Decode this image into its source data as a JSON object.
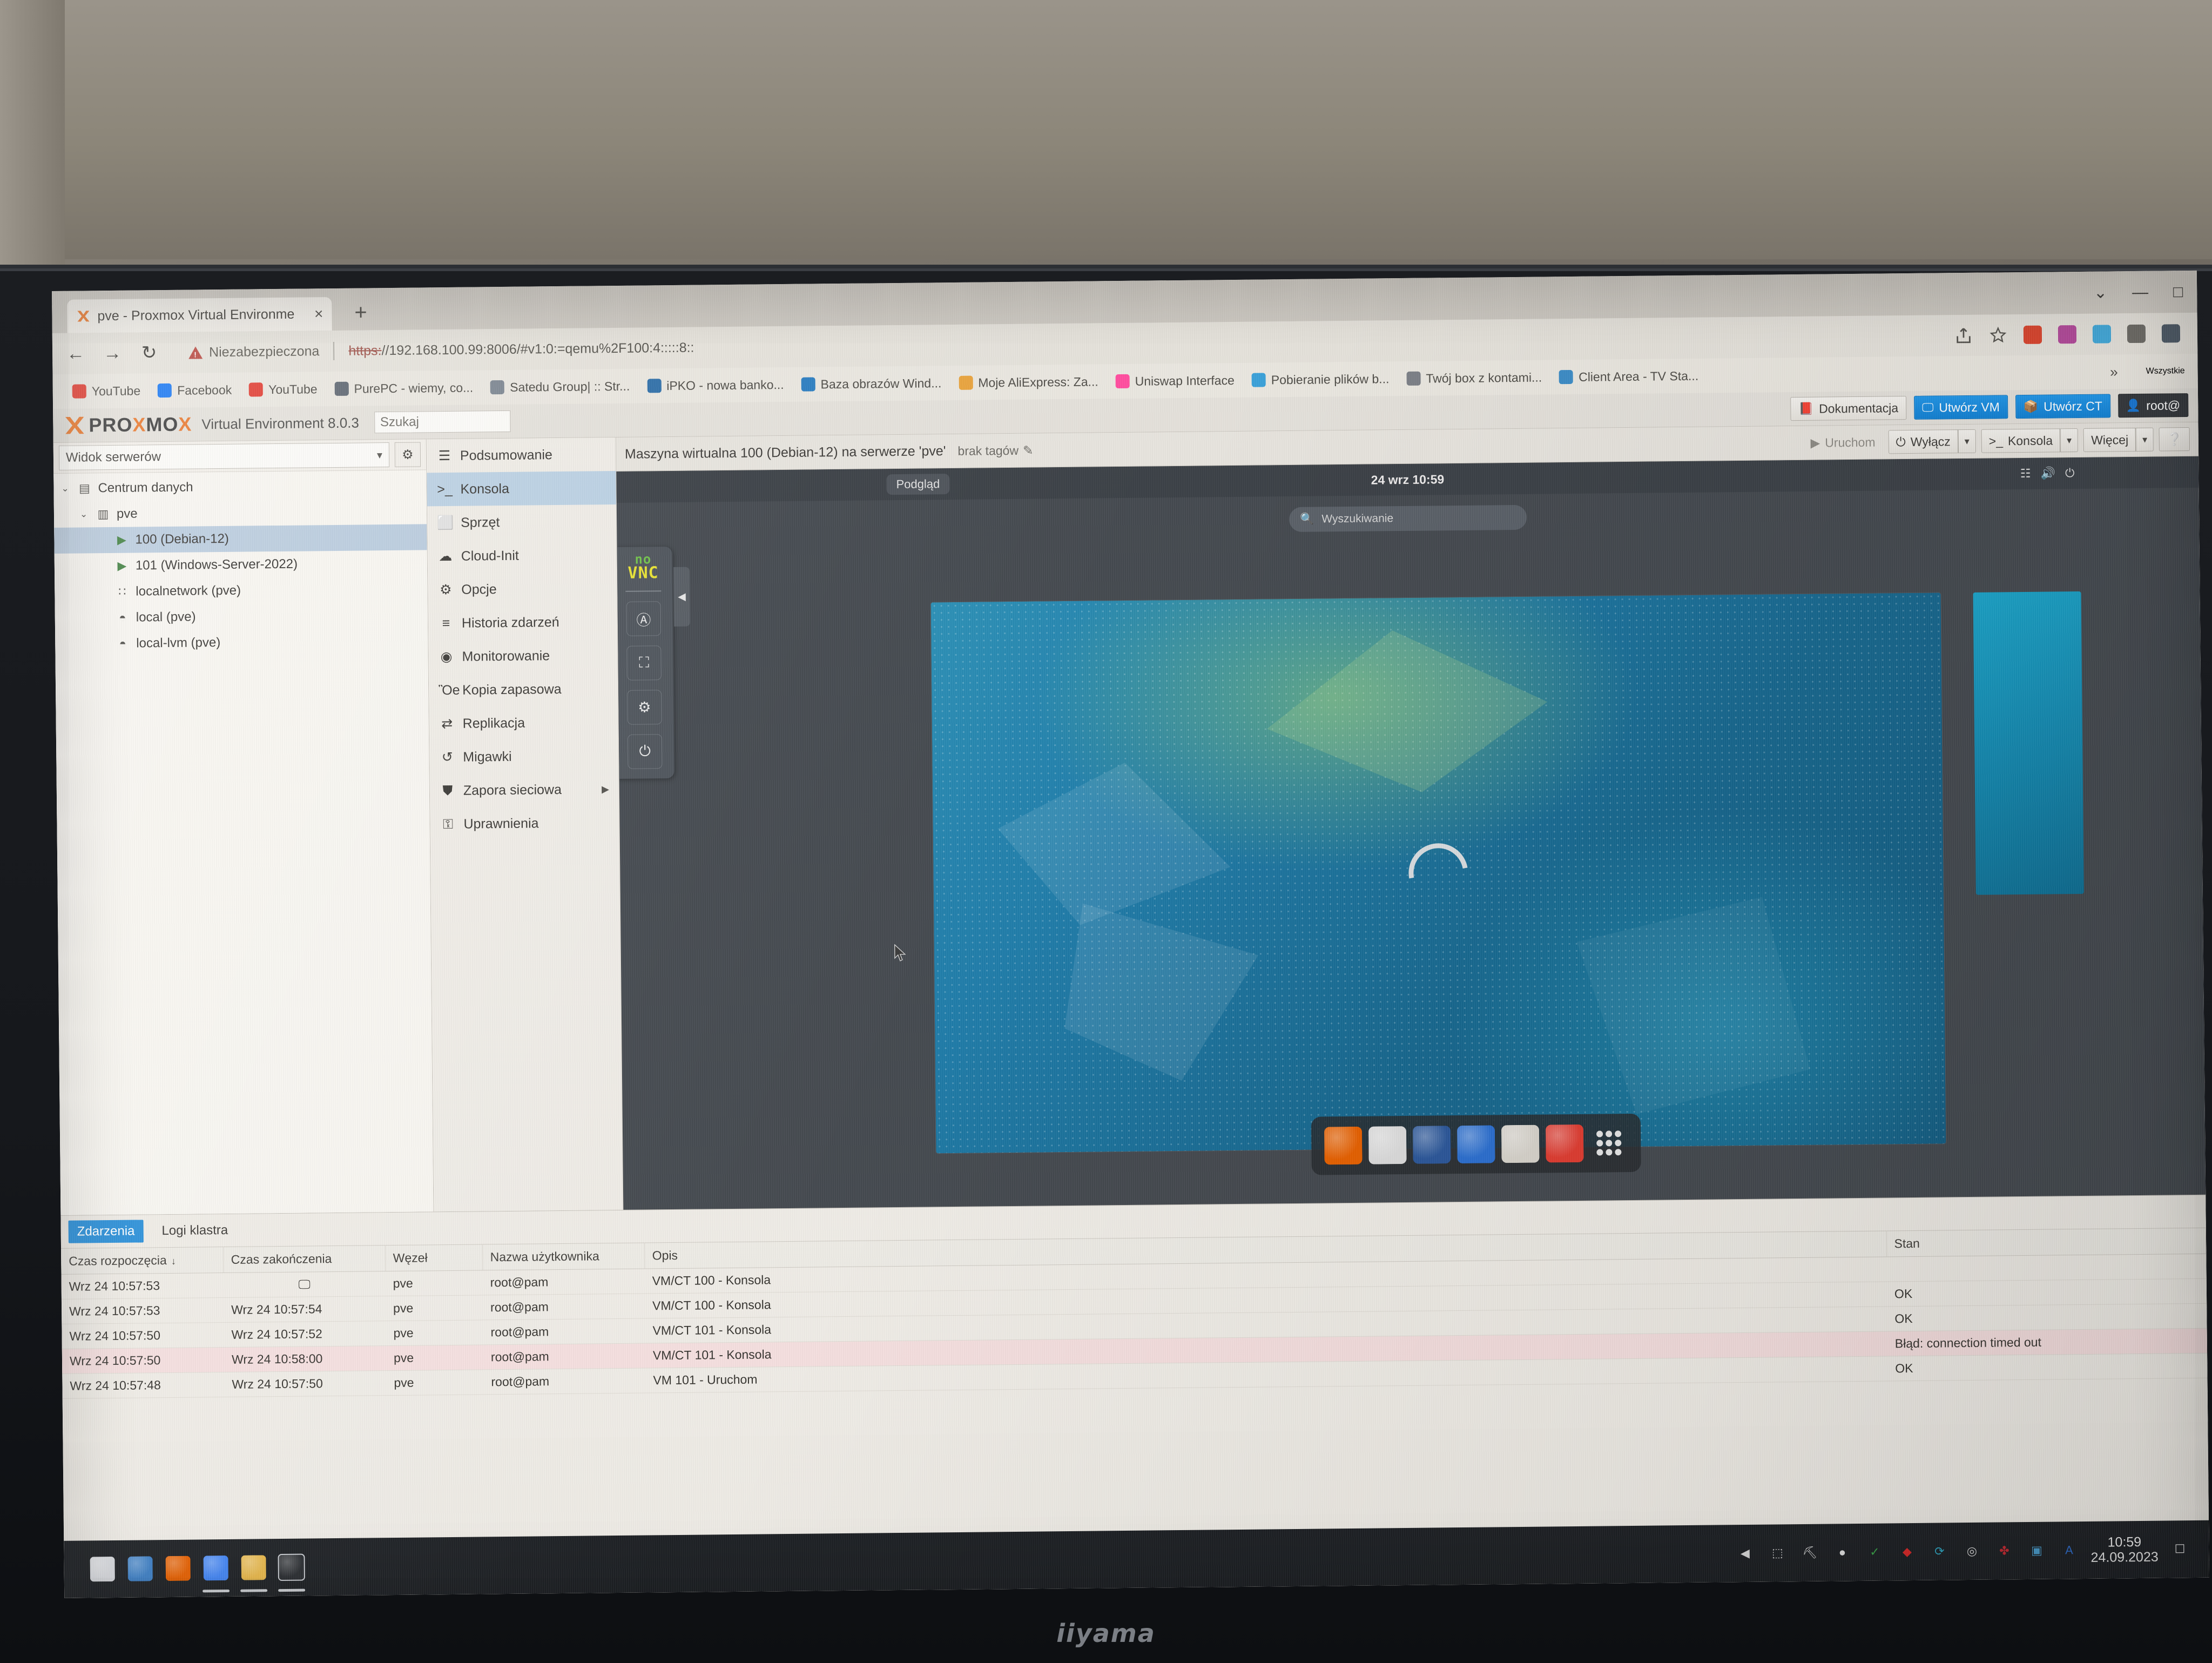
{
  "browser": {
    "tab": {
      "title": "pve - Proxmox Virtual Environme",
      "close": "×",
      "favicon_name": "proxmox-favicon"
    },
    "new_tab": "+",
    "window_controls": {
      "minimize": "—",
      "maximize": "□",
      "menu": "⌄"
    },
    "nav": {
      "back": "←",
      "forward": "→",
      "reload": "↻"
    },
    "security_label": "Niezabezpieczona",
    "url_scheme": "https:",
    "url_rest": "//192.168.100.99:8006/#v1:0:=qemu%2F100:4:::::8::",
    "bookmarks": [
      {
        "label": "YouTube",
        "icon": "youtube-icon",
        "color": "#e03c31"
      },
      {
        "label": "Facebook",
        "icon": "facebook-icon",
        "color": "#1877f2"
      },
      {
        "label": "YouTube",
        "icon": "youtube-icon",
        "color": "#e03c31"
      },
      {
        "label": "PurePC - wiemy, co...",
        "icon": "purepc-icon",
        "color": "#5d6570"
      },
      {
        "label": "Satedu Group| :: Str...",
        "icon": "satedu-icon",
        "color": "#7d8691"
      },
      {
        "label": "iPKO - nowa banko...",
        "icon": "ipko-icon",
        "color": "#2f6fa8"
      },
      {
        "label": "Baza obrazów Wind...",
        "icon": "windows-images-icon",
        "color": "#2c7ec0"
      },
      {
        "label": "Moje AliExpress: Za...",
        "icon": "aliexpress-icon",
        "color": "#e8a33d"
      },
      {
        "label": "Uniswap Interface",
        "icon": "uniswap-icon",
        "color": "#ff4d9e"
      },
      {
        "label": "Pobieranie plików b...",
        "icon": "download-icon",
        "color": "#3aa0d8"
      },
      {
        "label": "Twój box z kontami...",
        "icon": "box-icon",
        "color": "#7b7f86"
      },
      {
        "label": "Client Area - TV Sta...",
        "icon": "client-area-icon",
        "color": "#3c8cc6"
      }
    ],
    "bookmarks_overflow": "»",
    "bookmarks_all": "Wszystkie"
  },
  "proxmox": {
    "logo_text_left": "PRO",
    "logo_text_mid": "X",
    "logo_text_right": "MO",
    "logo_text_end": "X",
    "product": "Virtual Environment 8.0.3",
    "search_placeholder": "Szukaj",
    "topbar_buttons": [
      {
        "label": "Dokumentacja",
        "icon": "book-icon",
        "style": "plain"
      },
      {
        "label": "Utwórz VM",
        "icon": "monitor-icon",
        "style": "blue"
      },
      {
        "label": "Utwórz CT",
        "icon": "container-icon",
        "style": "blue"
      },
      {
        "label": "root@",
        "icon": "user-icon",
        "style": "dark"
      }
    ],
    "tree": {
      "view_selector": "Widok serwerów",
      "settings_icon": "gear-icon",
      "items": [
        {
          "label": "Centrum danych",
          "icon": "datacenter-icon",
          "depth": 0,
          "expander": "⌄",
          "selected": false
        },
        {
          "label": "pve",
          "icon": "node-icon",
          "depth": 1,
          "expander": "⌄",
          "selected": false
        },
        {
          "label": "100 (Debian-12)",
          "icon": "vm-running-icon",
          "depth": 2,
          "expander": "",
          "selected": true
        },
        {
          "label": "101 (Windows-Server-2022)",
          "icon": "vm-running-icon",
          "depth": 2,
          "expander": "",
          "selected": false
        },
        {
          "label": "localnetwork (pve)",
          "icon": "network-icon",
          "depth": 2,
          "expander": "",
          "selected": false
        },
        {
          "label": "local (pve)",
          "icon": "storage-icon",
          "depth": 2,
          "expander": "",
          "selected": false
        },
        {
          "label": "local-lvm (pve)",
          "icon": "storage-icon",
          "depth": 2,
          "expander": "",
          "selected": false
        }
      ]
    },
    "vm_menu": [
      {
        "label": "Podsumowanie",
        "icon": "book-icon",
        "glyph": "☰",
        "selected": false,
        "submenu": false
      },
      {
        "label": "Konsola",
        "icon": "terminal-icon",
        "glyph": ">_",
        "selected": true,
        "submenu": false
      },
      {
        "label": "Sprzęt",
        "icon": "monitor-icon",
        "glyph": "⬜",
        "selected": false,
        "submenu": false
      },
      {
        "label": "Cloud-Init",
        "icon": "cloud-icon",
        "glyph": "☁",
        "selected": false,
        "submenu": false
      },
      {
        "label": "Opcje",
        "icon": "gear-icon",
        "glyph": "⚙",
        "selected": false,
        "submenu": false
      },
      {
        "label": "Historia zdarzeń",
        "icon": "list-icon",
        "glyph": "≡",
        "selected": false,
        "submenu": false
      },
      {
        "label": "Monitorowanie",
        "icon": "eye-icon",
        "glyph": "◉",
        "selected": false,
        "submenu": false
      },
      {
        "label": "Kopia zapasowa",
        "icon": "save-icon",
        "glyph": "Ὃe",
        "selected": false,
        "submenu": false
      },
      {
        "label": "Replikacja",
        "icon": "replication-icon",
        "glyph": "⇄",
        "selected": false,
        "submenu": false
      },
      {
        "label": "Migawki",
        "icon": "snapshot-icon",
        "glyph": "↺",
        "selected": false,
        "submenu": false
      },
      {
        "label": "Zapora sieciowa",
        "icon": "shield-icon",
        "glyph": "⛊",
        "selected": false,
        "submenu": true
      },
      {
        "label": "Uprawnienia",
        "icon": "key-icon",
        "glyph": "⚿",
        "selected": false,
        "submenu": false
      }
    ],
    "content_header": {
      "title": "Maszyna wirtualna 100 (Debian-12) na serwerze 'pve'",
      "tags_label": "brak tagów",
      "tags_edit_icon": "pencil-icon",
      "buttons": {
        "start": "Uruchom",
        "shutdown": "Wyłącz",
        "console": "Konsola",
        "more": "Więcej",
        "help_icon": "help-icon"
      }
    }
  },
  "vnc": {
    "logo_top": "no",
    "logo_bottom": "VNC",
    "buttons": [
      {
        "name": "keyboard-icon",
        "glyph": "A"
      },
      {
        "name": "fullscreen-icon",
        "glyph": "⛶"
      },
      {
        "name": "settings-icon",
        "glyph": "⚙"
      },
      {
        "name": "power-icon",
        "glyph": "⏻"
      }
    ],
    "collapse_arrow": "◀",
    "guest": {
      "preview_label": "Podgląd",
      "clock": "24 wrz 10:59",
      "search_placeholder": "Wyszukiwanie",
      "search_icon": "search-icon",
      "tray_icons": [
        "network-icon",
        "volume-icon",
        "power-icon"
      ],
      "dock": [
        {
          "name": "firefox-icon",
          "color": "#e66000"
        },
        {
          "name": "thunderbird-icon",
          "color": "#dcdcdc"
        },
        {
          "name": "libreoffice-writer-icon",
          "color": "#2b579a"
        },
        {
          "name": "files-icon",
          "color": "#2b6fd0"
        },
        {
          "name": "software-icon",
          "color": "#d8d4cc"
        },
        {
          "name": "help-icon",
          "color": "#e03c31"
        },
        {
          "name": "show-apps-icon",
          "color": "#e8e8e8"
        }
      ]
    }
  },
  "logs": {
    "tabs": [
      {
        "label": "Zdarzenia",
        "active": true
      },
      {
        "label": "Logi klastra",
        "active": false
      }
    ],
    "columns": [
      "Czas rozpoczęcia",
      "Czas zakończenia",
      "Węzeł",
      "Nazwa użytkownika",
      "Opis",
      "Stan"
    ],
    "sort_indicator": "↓",
    "rows": [
      {
        "start": "Wrz 24 10:57:53",
        "end": "",
        "end_icon": "monitor-icon",
        "node": "pve",
        "user": "root@pam",
        "desc": "VM/CT 100 - Konsola",
        "state": "",
        "error": false
      },
      {
        "start": "Wrz 24 10:57:53",
        "end": "Wrz 24 10:57:54",
        "end_icon": "",
        "node": "pve",
        "user": "root@pam",
        "desc": "VM/CT 100 - Konsola",
        "state": "OK",
        "error": false
      },
      {
        "start": "Wrz 24 10:57:50",
        "end": "Wrz 24 10:57:52",
        "end_icon": "",
        "node": "pve",
        "user": "root@pam",
        "desc": "VM/CT 101 - Konsola",
        "state": "OK",
        "error": false
      },
      {
        "start": "Wrz 24 10:57:50",
        "end": "Wrz 24 10:58:00",
        "end_icon": "",
        "node": "pve",
        "user": "root@pam",
        "desc": "VM/CT 101 - Konsola",
        "state": "Błąd: connection timed out",
        "error": true
      },
      {
        "start": "Wrz 24 10:57:48",
        "end": "Wrz 24 10:57:50",
        "end_icon": "",
        "node": "pve",
        "user": "root@pam",
        "desc": "VM 101 - Uruchom",
        "state": "OK",
        "error": false
      }
    ]
  },
  "taskbar": {
    "items": [
      {
        "name": "start-button",
        "icon": "windows-icon",
        "running": false
      },
      {
        "name": "taskbar-save-app",
        "icon": "floppy-icon",
        "running": false
      },
      {
        "name": "taskbar-firefox",
        "icon": "firefox-icon",
        "running": false
      },
      {
        "name": "taskbar-chrome",
        "icon": "chrome-icon",
        "running": true
      },
      {
        "name": "taskbar-explorer",
        "icon": "folder-icon",
        "running": true
      },
      {
        "name": "taskbar-terminal",
        "icon": "terminal-icon",
        "running": true
      }
    ],
    "tray": [
      {
        "name": "tray-autocad-icon",
        "glyph": "A",
        "color": "#2f6fd0"
      },
      {
        "name": "tray-image-icon",
        "glyph": "▣",
        "color": "#4a9fd0"
      },
      {
        "name": "tray-raspberry-icon",
        "glyph": "✤",
        "color": "#c62a33"
      },
      {
        "name": "tray-device-icon",
        "glyph": "◎",
        "color": "#d8d8d8"
      },
      {
        "name": "tray-teamviewer-icon",
        "glyph": "⟳",
        "color": "#2fa8c4"
      },
      {
        "name": "tray-anydesk-icon",
        "glyph": "◆",
        "color": "#e02a2a"
      },
      {
        "name": "tray-defender-icon",
        "glyph": "✓",
        "color": "#3ba84a"
      },
      {
        "name": "tray-dropbox-icon",
        "glyph": "●",
        "color": "#e8e8e8"
      },
      {
        "name": "tray-usb-icon",
        "glyph": "⛏",
        "color": "#e0e0e0"
      },
      {
        "name": "tray-network-icon",
        "glyph": "⬚",
        "color": "#e0e0e0"
      },
      {
        "name": "tray-volume-icon",
        "glyph": "◀",
        "color": "#e0e0e0"
      }
    ],
    "clock_time": "10:59",
    "clock_date": "24.09.2023",
    "notification_icon": "notification-icon"
  },
  "monitor": {
    "brand": "iiyama"
  }
}
